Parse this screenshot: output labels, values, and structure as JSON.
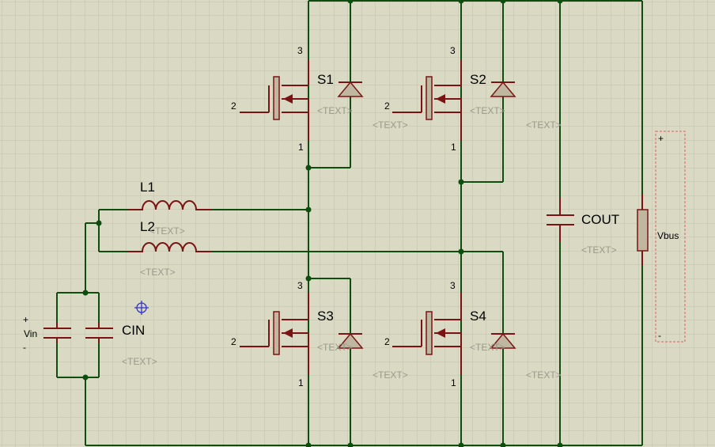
{
  "components": {
    "s1": {
      "name": "S1",
      "text": "<TEXT>",
      "gate_pin": "2",
      "drain_pin": "3",
      "source_pin": "1"
    },
    "s2": {
      "name": "S2",
      "text": "<TEXT>",
      "gate_pin": "2",
      "drain_pin": "3",
      "source_pin": "1"
    },
    "s3": {
      "name": "S3",
      "text": "<TEXT>",
      "gate_pin": "2",
      "drain_pin": "3",
      "source_pin": "1"
    },
    "s4": {
      "name": "S4",
      "text": "<TEXT>",
      "gate_pin": "2",
      "drain_pin": "3",
      "source_pin": "1"
    },
    "l1": {
      "name": "L1"
    },
    "l2": {
      "name": "L2",
      "text": "<TEXT>"
    },
    "l2_text2": "<TEXT>",
    "cin": {
      "name": "CIN",
      "text": "<TEXT>"
    },
    "cout": {
      "name": "COUT",
      "text": "<TEXT>"
    },
    "vin": {
      "name": "Vin",
      "plus": "+",
      "minus": "-"
    },
    "vbus": {
      "name": "Vbus",
      "plus": "+",
      "minus": "-"
    },
    "s1_extra_text": "<TEXT>",
    "s2_extra_text": "<TEXT>",
    "s3_extra_text": "<TEXT>",
    "s4_extra_text": "<TEXT>"
  },
  "colors": {
    "background": "#d9d9c4",
    "grid": "#c2c2ac",
    "wire": "#0d4d0d",
    "component": "#7a1414",
    "placeholder_text": "#9a9a8a",
    "probe_box": "#e06060",
    "marker": "#3333cc"
  },
  "icons": {
    "placement_marker": "crosshair-circle-icon"
  }
}
